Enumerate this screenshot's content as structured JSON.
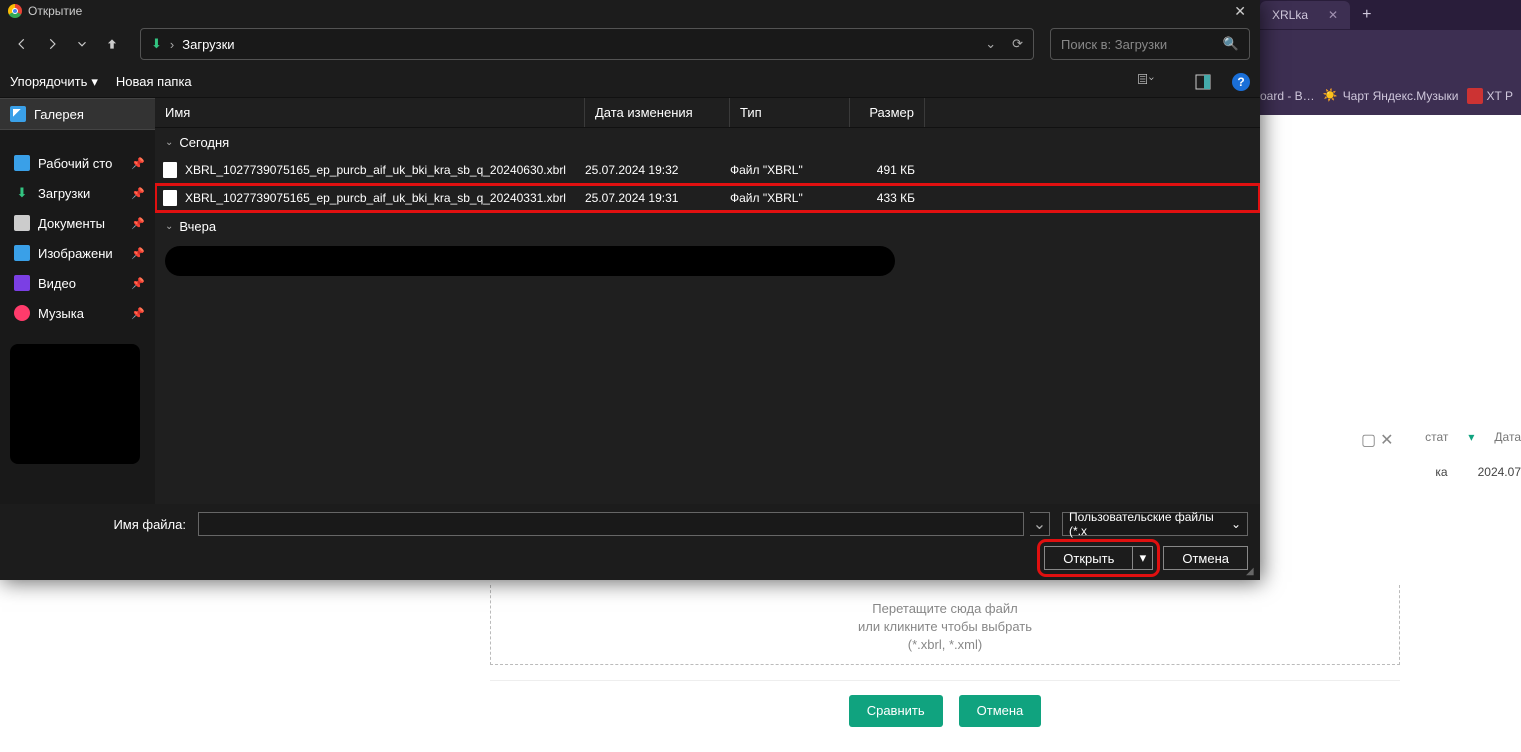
{
  "browser": {
    "tab_label": "XRLka",
    "bookmarks": [
      {
        "label": "oard - B…"
      },
      {
        "label": "Чарт Яндекс.Музыки"
      },
      {
        "label": "XT P"
      }
    ]
  },
  "dialog": {
    "title": "Открытие",
    "breadcrumb": "Загрузки",
    "search_placeholder": "Поиск в: Загрузки",
    "organize": "Упорядочить",
    "new_folder": "Новая папка",
    "sidebar": {
      "gallery": "Галерея",
      "items": [
        {
          "label": "Рабочий сто"
        },
        {
          "label": "Загрузки"
        },
        {
          "label": "Документы"
        },
        {
          "label": "Изображени"
        },
        {
          "label": "Видео"
        },
        {
          "label": "Музыка"
        }
      ]
    },
    "columns": {
      "name": "Имя",
      "date": "Дата изменения",
      "type": "Тип",
      "size": "Размер"
    },
    "groups": [
      {
        "label": "Сегодня",
        "files": [
          {
            "name": "XBRL_1027739075165_ep_purcb_aif_uk_bki_kra_sb_q_20240630.xbrl",
            "date": "25.07.2024 19:32",
            "type": "Файл \"XBRL\"",
            "size": "491 КБ",
            "highlight": false
          },
          {
            "name": "XBRL_1027739075165_ep_purcb_aif_uk_bki_kra_sb_q_20240331.xbrl",
            "date": "25.07.2024 19:31",
            "type": "Файл \"XBRL\"",
            "size": "433 КБ",
            "highlight": true
          }
        ]
      },
      {
        "label": "Вчера",
        "files": []
      }
    ],
    "footer": {
      "filename_label": "Имя файла:",
      "filter_label": "Пользовательские файлы (*.x",
      "open": "Открыть",
      "cancel": "Отмена"
    }
  },
  "page": {
    "side_headers": {
      "status": "стат",
      "date": "Дата"
    },
    "side_row": {
      "status": "ка",
      "date": "2024.07"
    },
    "drop_line1": "Перетащите сюда файл",
    "drop_line2": "или кликните чтобы выбрать",
    "drop_line3": "(*.xbrl, *.xml)",
    "compare": "Сравнить",
    "cancel": "Отмена"
  }
}
